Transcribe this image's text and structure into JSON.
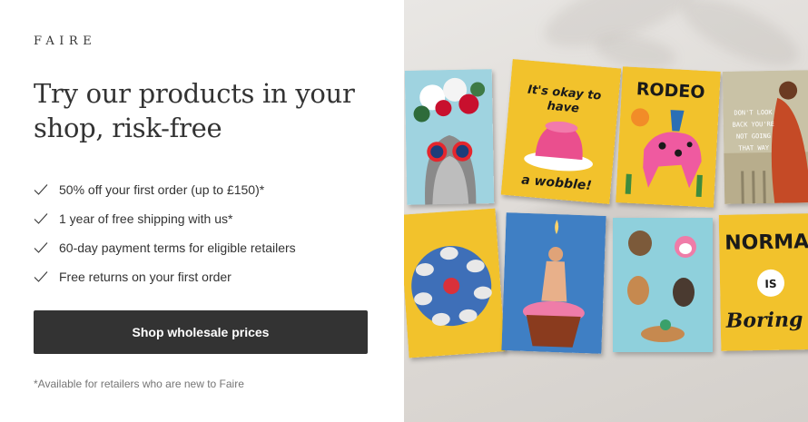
{
  "brand": {
    "logo": "FAIRE"
  },
  "headline": "Try our products in your shop, risk-free",
  "benefits": [
    {
      "icon": "check-icon",
      "text": "50% off your first order (up to £150)*"
    },
    {
      "icon": "check-icon",
      "text": "1 year of free shipping with us*"
    },
    {
      "icon": "check-icon",
      "text": "60-day payment terms for eligible retailers"
    },
    {
      "icon": "check-icon",
      "text": "Free returns on your first order"
    }
  ],
  "cta": {
    "label": "Shop wholesale prices"
  },
  "footnote": "*Available for retailers who are new to Faire",
  "colors": {
    "button": "#333333",
    "button_text": "#ffffff",
    "text": "#333333",
    "muted": "#757575",
    "card_yellow": "#f2c22c",
    "card_blue": "#8fd0dc"
  },
  "cards": {
    "okay": {
      "line1": "It's okay to",
      "line2": "have",
      "line3": "a wobble!"
    },
    "rodeo": {
      "title": "RODEO"
    },
    "dont_look_back": {
      "text": "DON'T LOOK BACK YOU'RE NOT GOING THAT WAY"
    },
    "normal": {
      "line1": "NORMAL",
      "line2": "IS",
      "line3": "Boring"
    }
  }
}
